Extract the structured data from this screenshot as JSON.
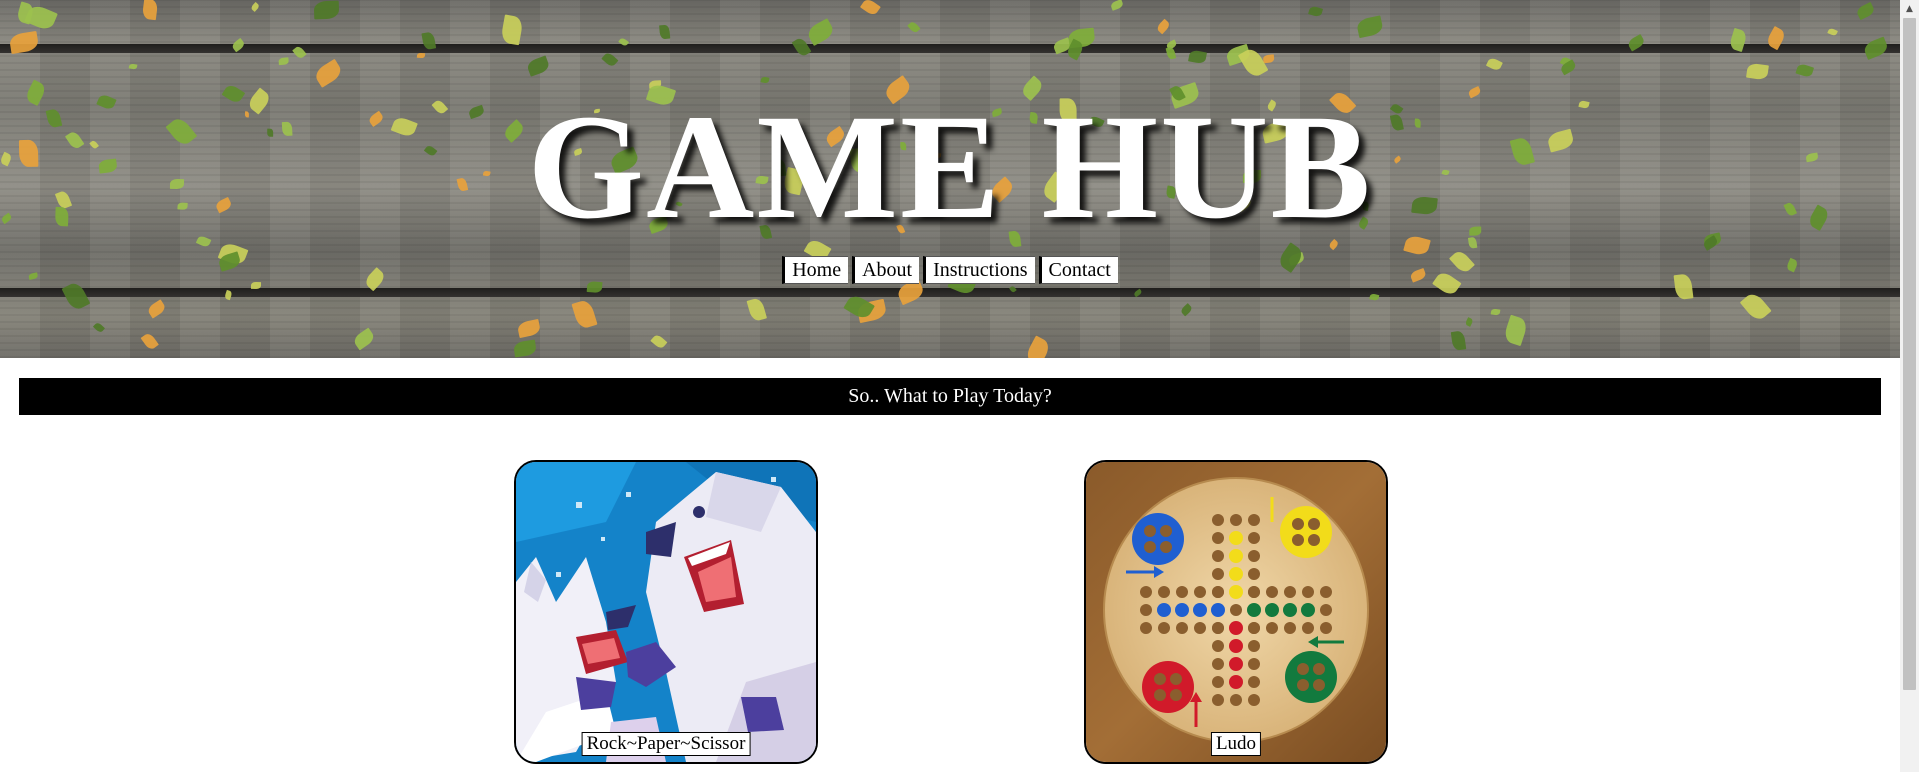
{
  "header": {
    "title": "GAME HUB",
    "nav": [
      "Home",
      "About",
      "Instructions",
      "Contact"
    ]
  },
  "banner": {
    "text": "So.. What to Play Today?"
  },
  "games": [
    {
      "label": "Rock~Paper~Scissor",
      "icon": "polar-bear-wolf-illustration"
    },
    {
      "label": "Ludo",
      "icon": "ludo-board"
    }
  ],
  "colors": {
    "banner_bg": "#000000",
    "title": "#ffffff",
    "wood": "#7f7e77",
    "ludo_red": "#d11a2a",
    "ludo_blue": "#1f5fd1",
    "ludo_yellow": "#f2dc1a",
    "ludo_green": "#127a3e"
  }
}
